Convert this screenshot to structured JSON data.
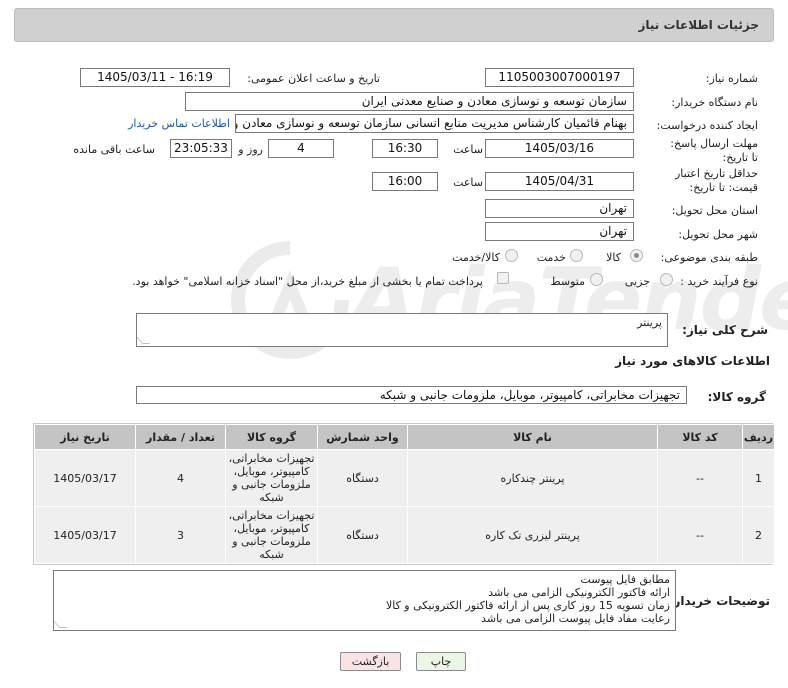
{
  "header": {
    "title": "جزئیات اطلاعات نیاز"
  },
  "watermark": {
    "text": "AriaTender.net"
  },
  "fields": {
    "need_number_label": "شماره نیاز:",
    "need_number": "1105003007000197",
    "announce_label": "تاریخ و ساعت اعلان عمومی:",
    "announce_value": "1405/03/11 - 16:19",
    "buyer_org_label": "نام دستگاه خریدار:",
    "buyer_org": "سازمان توسعه و نوسازی معادن و صنایع معدنی ایران",
    "creator_label": "ایجاد کننده درخواست:",
    "creator": "بهنام قائمیان کارشناس مدیریت منابع انسانی سازمان توسعه و نوسازی معادن و",
    "contact_link": "اطلاعات تماس خریدار",
    "reply_deadline_label": "مهلت ارسال پاسخ: تا تاریخ:",
    "reply_date": "1405/03/16",
    "time_label": "ساعت",
    "reply_time": "16:30",
    "days_value": "4",
    "days_label": "روز و",
    "remaining_value": "23:05:33",
    "remaining_label": "ساعت باقی مانده",
    "validity_label": "حداقل تاریخ اعتبار قیمت: تا تاریخ:",
    "validity_date": "1405/04/31",
    "validity_time_label": "ساعت",
    "validity_time": "16:00",
    "province_label": "استان محل تحویل:",
    "province": "تهران",
    "city_label": "شهر محل تحویل:",
    "city": "تهران",
    "category_label": "طبقه بندی موضوعی:",
    "category_options": [
      "کالا",
      "خدمت",
      "کالا/خدمت"
    ],
    "process_label": "نوع فرآیند خرید :",
    "process_options": [
      "جزیی",
      "متوسط"
    ],
    "payment_note": "پرداخت تمام یا بخشی از مبلغ خرید،از محل \"اسناد خزانه اسلامی\" خواهد بود."
  },
  "description": {
    "label": "شرح کلی نیاز:",
    "value": "پرینتر"
  },
  "goods_section": {
    "title": "اطلاعات کالاهای مورد نیاز",
    "group_label": "گروه کالا:",
    "group_value": "تجهیزات مخابراتی، کامپیوتر، موبایل، ملزومات جانبی و شبکه"
  },
  "table": {
    "headers": [
      "ردیف",
      "کد کالا",
      "نام کالا",
      "واحد شمارش",
      "گروه کالا",
      "تعداد / مقدار",
      "تاریخ نیاز"
    ],
    "rows": [
      {
        "row": "1",
        "code": "--",
        "name": "پرینتر چندکاره",
        "unit": "دستگاه",
        "group": "تجهیزات مخابراتی، کامپیوتر، موبایل، ملزومات جانبی و شبکه",
        "qty": "4",
        "date": "1405/03/17"
      },
      {
        "row": "2",
        "code": "--",
        "name": "پرینتر لیزری تک کاره",
        "unit": "دستگاه",
        "group": "تجهیزات مخابراتی، کامپیوتر، موبایل، ملزومات جانبی و شبکه",
        "qty": "3",
        "date": "1405/03/17"
      }
    ]
  },
  "buyer_notes": {
    "label": "توضیحات خریدار:",
    "lines": [
      "مطابق فایل پیوست",
      "ارائه فاکتور الکترونیکی الزامی می باشد",
      "زمان تسویه 15 روز کاری پس از ارائه فاکتور الکترونیکی و کالا",
      "رعایت مفاد فایل پیوست الزامی می باشد"
    ]
  },
  "buttons": {
    "print": "چاپ",
    "back": "بازگشت"
  },
  "colors": {
    "header_bg": "#d0d0d0",
    "table_header_bg": "#c4c4c4",
    "row_bg": "#efefef",
    "link": "#1a56b8",
    "print_btn": "#eaf7e6",
    "back_btn": "#fbe3e3"
  }
}
